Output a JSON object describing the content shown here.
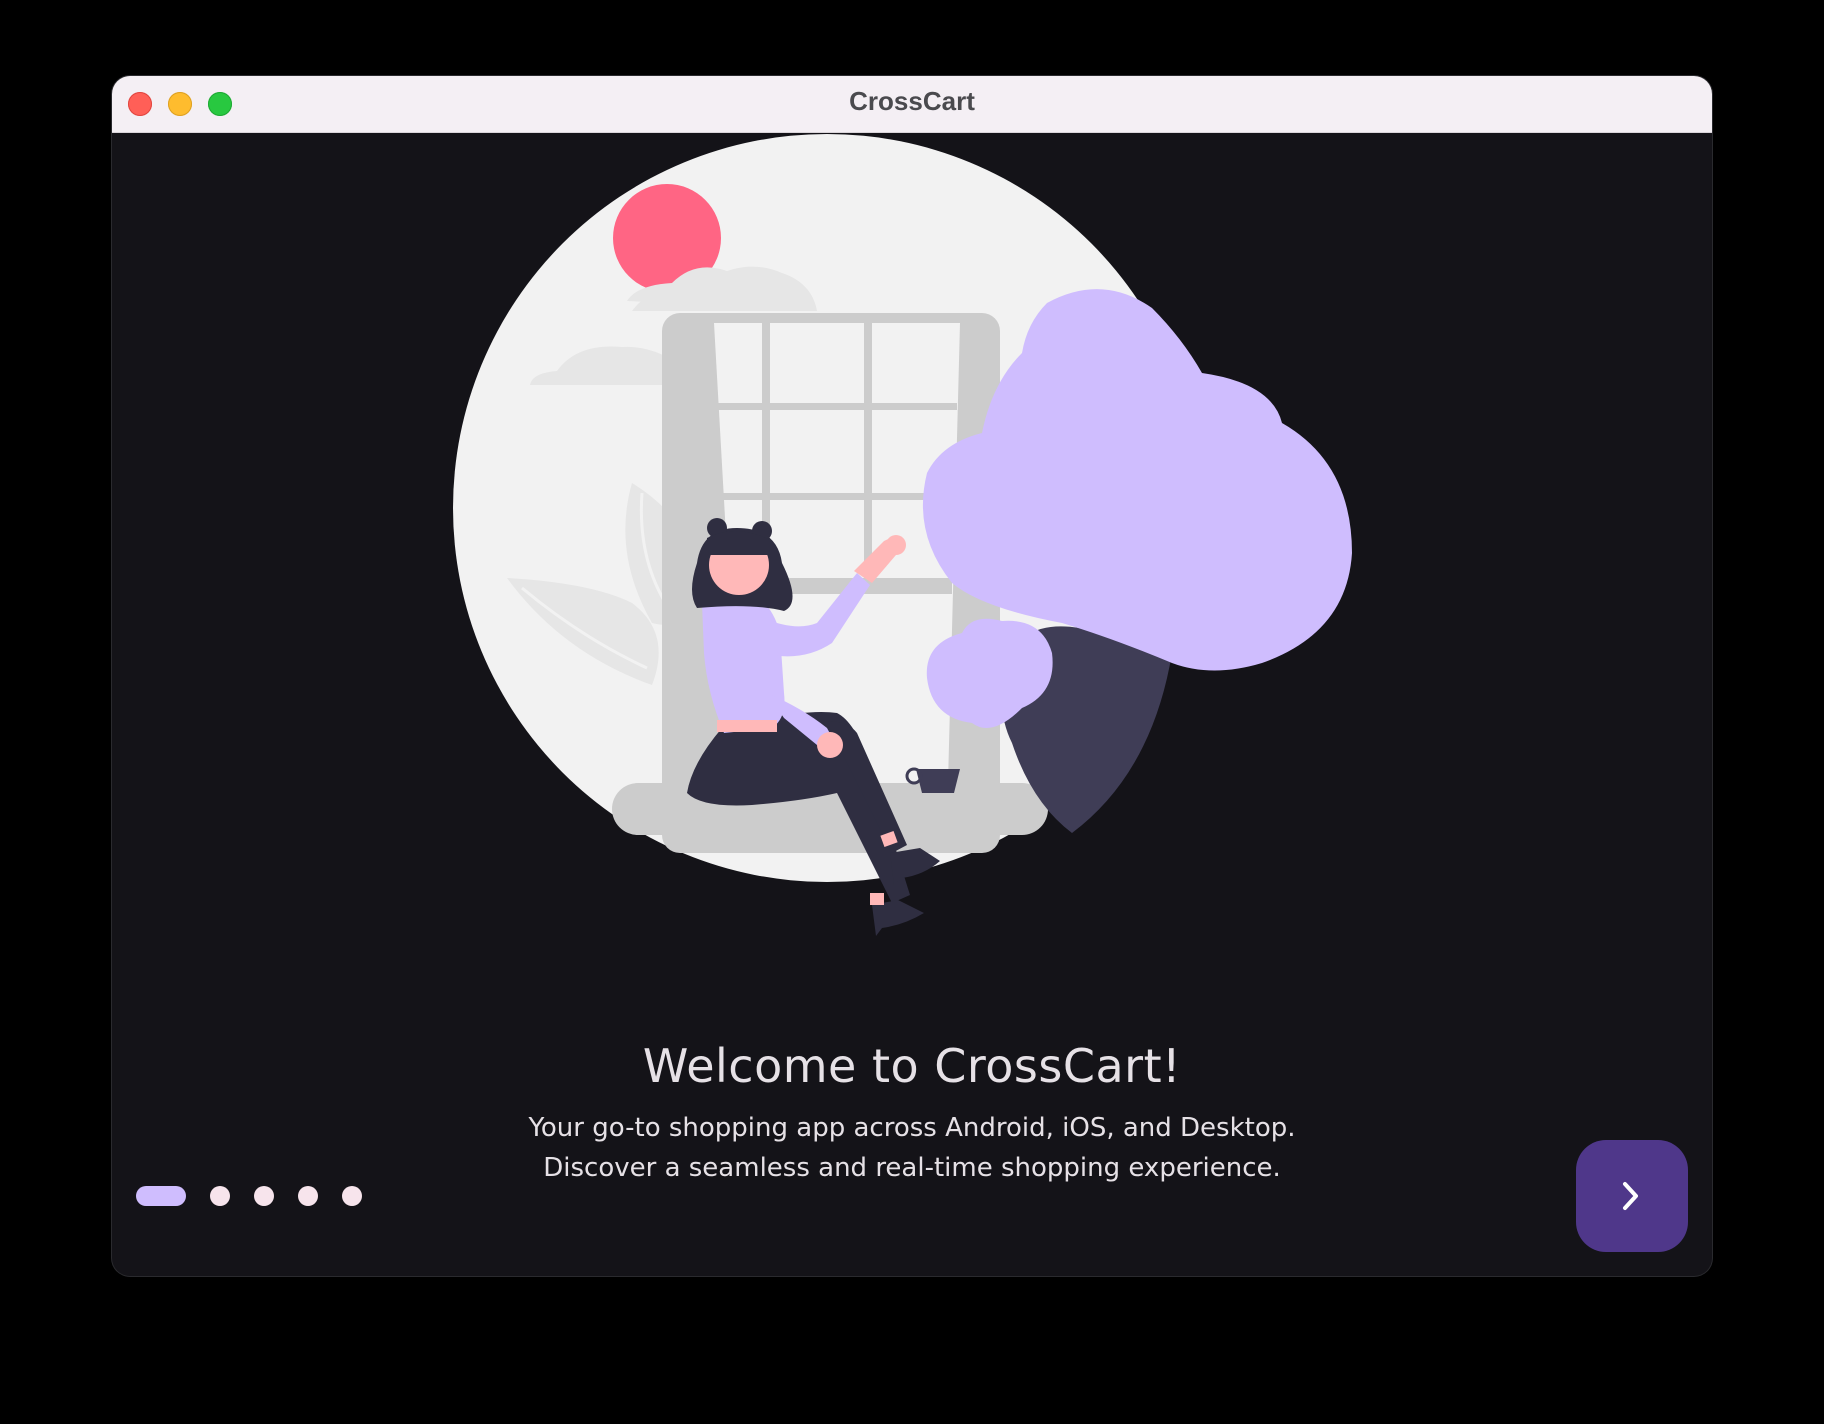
{
  "window": {
    "title": "CrossCart",
    "controls": [
      "close",
      "minimize",
      "maximize"
    ]
  },
  "onboarding": {
    "headline": "Welcome to CrossCart!",
    "description_line1": "Your go-to shopping app across Android, iOS, and Desktop.",
    "description_line2": "Discover a seamless and real-time shopping experience.",
    "page_indicator": {
      "total_pages": 5,
      "current_page": 1
    },
    "next_button": {
      "icon": "chevron-right-icon"
    },
    "illustration": "woman-sitting-at-window-illustration"
  },
  "colors": {
    "background": "#141318",
    "accent": "#cfbdfe",
    "button": "#4f378a",
    "sun": "#ff6584",
    "text": "#e6e1e6"
  }
}
